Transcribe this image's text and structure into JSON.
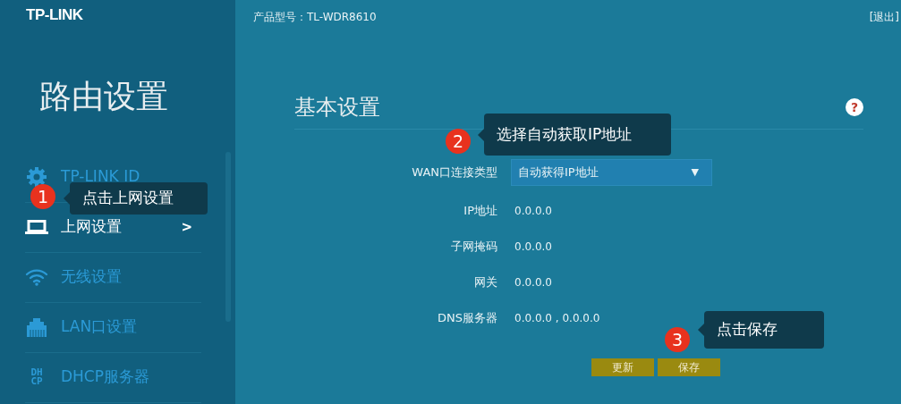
{
  "header": {
    "logo": "TP-LINK",
    "model": "产品型号：TL-WDR8610",
    "logout": "[退出]"
  },
  "sidebar": {
    "title": "路由设置",
    "items": [
      {
        "label": "TP-LINK ID",
        "kind": "gear",
        "selected": false
      },
      {
        "label": "上网设置",
        "kind": "laptop",
        "selected": true,
        "chevron": ">"
      },
      {
        "label": "无线设置",
        "kind": "wifi",
        "selected": false
      },
      {
        "label": "LAN口设置",
        "kind": "lan",
        "selected": false
      },
      {
        "label": "DHCP服务器",
        "kind": "dhcp",
        "selected": false,
        "icon_text": [
          "DH",
          "CP"
        ]
      }
    ]
  },
  "main": {
    "title": "基本设置",
    "help": "?",
    "fields": [
      {
        "kind": "select",
        "label": "WAN口连接类型",
        "value": "自动获得IP地址",
        "caret": "▼"
      },
      {
        "kind": "text",
        "label": "IP地址",
        "value": "0.0.0.0"
      },
      {
        "kind": "text",
        "label": "子网掩码",
        "value": "0.0.0.0"
      },
      {
        "kind": "text",
        "label": "网关",
        "value": "0.0.0.0"
      },
      {
        "kind": "text",
        "label": "DNS服务器",
        "value": "0.0.0.0 , 0.0.0.0"
      }
    ],
    "buttons": [
      "更新",
      "保存"
    ]
  },
  "callouts": [
    {
      "number": "1",
      "text": "点击上网设置"
    },
    {
      "number": "2",
      "text": "选择自动获取IP地址"
    },
    {
      "number": "3",
      "text": "点击保存"
    }
  ]
}
